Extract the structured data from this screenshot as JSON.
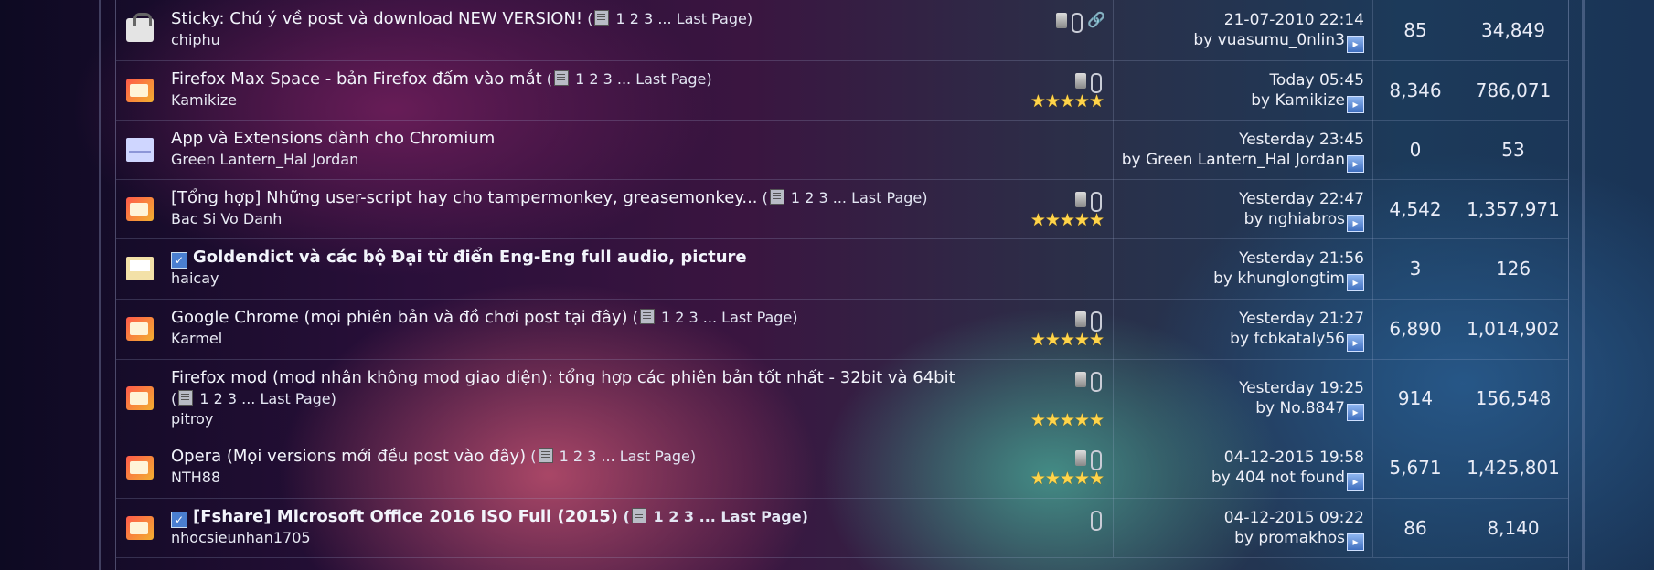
{
  "threads": [
    {
      "icon": "sticky",
      "prefix": "Sticky:",
      "title": "Chú ý về post và download NEW VERSION!",
      "bold": false,
      "check": false,
      "pages": "1 2 3 ... Last Page",
      "author": "chiphu",
      "icons": [
        "trash",
        "clip",
        "link"
      ],
      "stars": 0,
      "last_date": "21-07-2010 22:14",
      "last_by": "by vuasumu_0nlin3",
      "replies": "85",
      "views": "34,849"
    },
    {
      "icon": "hot",
      "prefix": "",
      "title": "Firefox Max Space - bản Firefox đấm vào mắt",
      "bold": false,
      "check": false,
      "pages": "1 2 3 ... Last Page",
      "author": "Kamikize",
      "icons": [
        "trash",
        "clip"
      ],
      "stars": 5,
      "last_date": "Today 05:45",
      "last_by": "by Kamikize",
      "replies": "8,346",
      "views": "786,071"
    },
    {
      "icon": "mail",
      "prefix": "",
      "title": "App và Extensions dành cho Chromium",
      "bold": false,
      "check": false,
      "pages": "",
      "author": "Green Lantern_Hal Jordan",
      "icons": [],
      "stars": 0,
      "last_date": "Yesterday 23:45",
      "last_by": "by Green Lantern_Hal Jordan",
      "replies": "0",
      "views": "53"
    },
    {
      "icon": "hot",
      "prefix": "",
      "title": "[Tổng hợp] Những user-script hay cho tampermonkey, greasemonkey...",
      "bold": false,
      "check": false,
      "pages": "1 2 3 ... Last Page",
      "author": "Bac Si Vo Danh",
      "icons": [
        "trash",
        "clip"
      ],
      "stars": 5,
      "last_date": "Yesterday 22:47",
      "last_by": "by nghiabros",
      "replies": "4,542",
      "views": "1,357,971"
    },
    {
      "icon": "open",
      "prefix": "",
      "title": "Goldendict và các bộ Đại từ điển Eng-Eng full audio, picture",
      "bold": true,
      "check": true,
      "pages": "",
      "author": "haicay",
      "icons": [],
      "stars": 0,
      "last_date": "Yesterday 21:56",
      "last_by": "by khunglongtim",
      "replies": "3",
      "views": "126"
    },
    {
      "icon": "hot",
      "prefix": "",
      "title": "Google Chrome (mọi phiên bản và đồ chơi post tại đây)",
      "bold": false,
      "check": false,
      "pages": "1 2 3 ... Last Page",
      "author": "Karmel",
      "icons": [
        "trash",
        "clip"
      ],
      "stars": 5,
      "last_date": "Yesterday 21:27",
      "last_by": "by fcbkataly56",
      "replies": "6,890",
      "views": "1,014,902"
    },
    {
      "icon": "hot",
      "prefix": "",
      "title": "Firefox mod (mod nhân không mod giao diện): tổng hợp các phiên bản tốt nhất - 32bit và 64bit",
      "bold": false,
      "check": false,
      "pages": "1 2 3 ... Last Page",
      "author": "pitroy",
      "icons": [
        "trash",
        "clip"
      ],
      "stars": 5,
      "last_date": "Yesterday 19:25",
      "last_by": "by No.8847",
      "replies": "914",
      "views": "156,548",
      "wrap": true
    },
    {
      "icon": "hot",
      "prefix": "",
      "title": "Opera (Mọi versions mới đều post vào đây)",
      "bold": false,
      "check": false,
      "pages": "1 2 3 ... Last Page",
      "author": "NTH88",
      "icons": [
        "trash",
        "clip"
      ],
      "stars": 5,
      "last_date": "04-12-2015 19:58",
      "last_by": "by 404 not found",
      "replies": "5,671",
      "views": "1,425,801"
    },
    {
      "icon": "hot",
      "prefix": "",
      "title": "[Fshare] Microsoft Office 2016 ISO Full (2015)",
      "bold": true,
      "check": true,
      "pages": "1 2 3 ... Last Page",
      "author": "nhocsieunhan1705",
      "icons": [
        "clip"
      ],
      "stars": 0,
      "last_date": "04-12-2015 09:22",
      "last_by": "by promakhos",
      "replies": "86",
      "views": "8,140"
    }
  ]
}
